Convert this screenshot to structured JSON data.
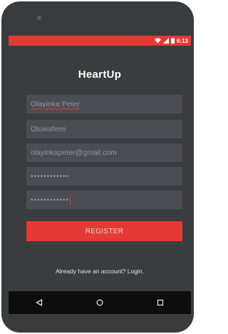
{
  "status_bar": {
    "time": "6:13",
    "icons": [
      "wifi-icon",
      "signal-icon",
      "battery-icon"
    ]
  },
  "app": {
    "title": "HeartUp"
  },
  "form": {
    "first_name": "Olayinka Peter",
    "last_name": "Oluwafemi",
    "email": "olayinkapeter@gmail.com",
    "password": "••••••••••••",
    "confirm_password": "••••••••••••",
    "register_label": "REGISTER",
    "login_prompt": "Already have an account? Login."
  },
  "nav_bar": {
    "buttons": [
      "back-icon",
      "home-icon",
      "recents-icon"
    ]
  },
  "colors": {
    "accent": "#e53935",
    "background": "#3b3c3f",
    "field": "#4a4d53"
  }
}
